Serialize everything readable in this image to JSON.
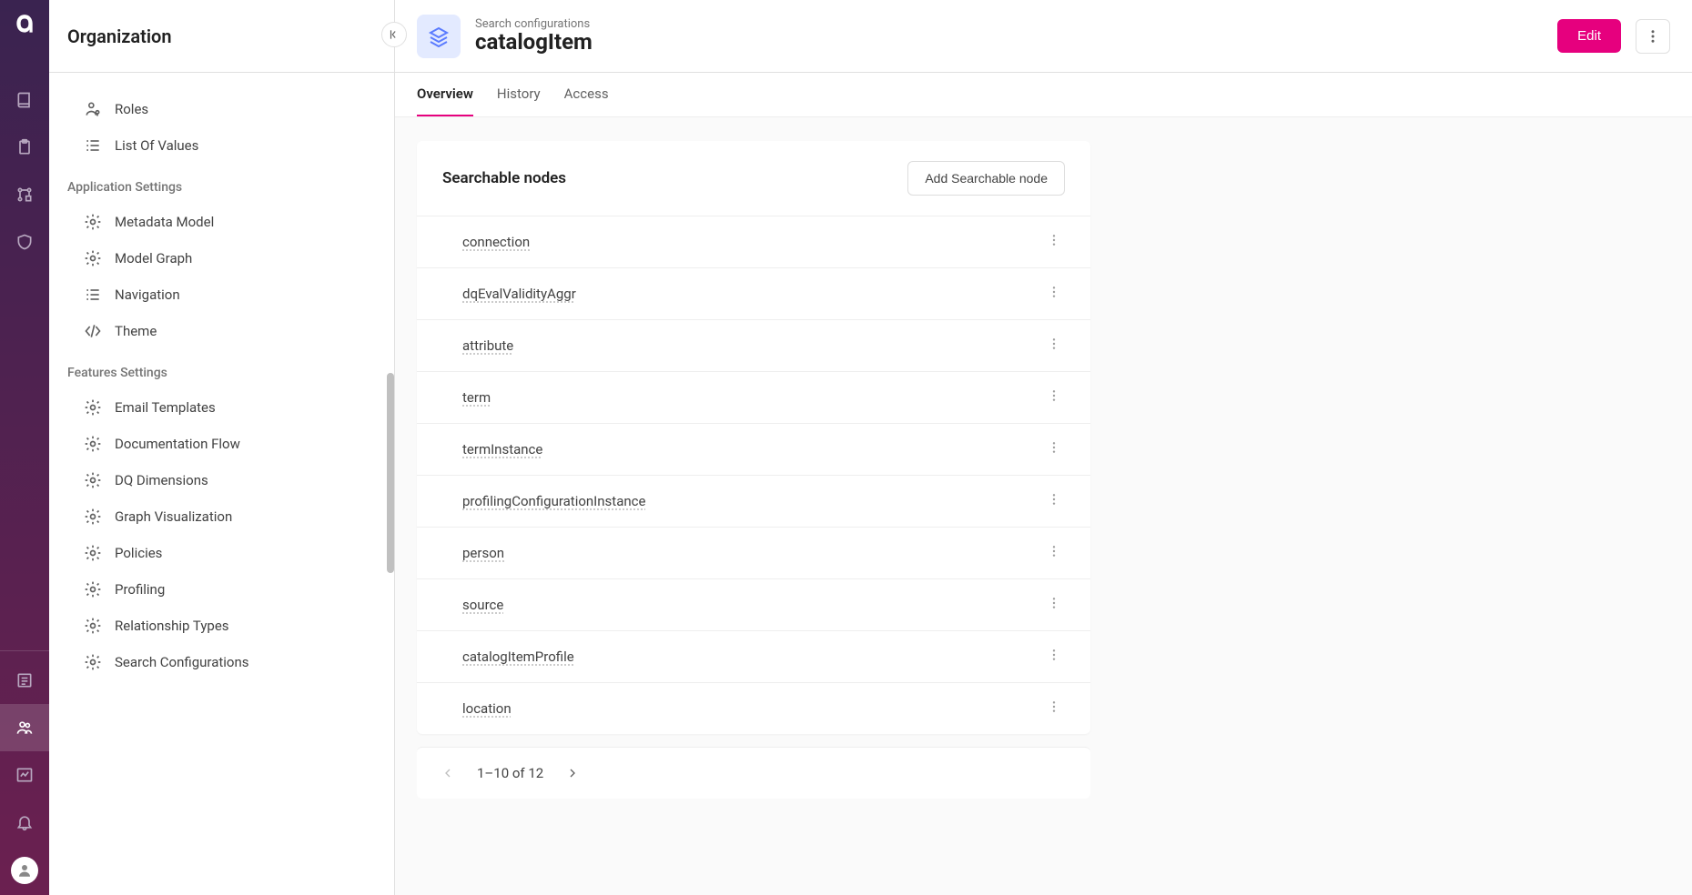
{
  "rail": {
    "logo": "a"
  },
  "sidebar": {
    "title": "Organization",
    "groups": [
      {
        "items": [
          {
            "label": "Roles"
          },
          {
            "label": "List Of Values"
          }
        ]
      },
      {
        "heading": "Application Settings",
        "items": [
          {
            "label": "Metadata Model"
          },
          {
            "label": "Model Graph"
          },
          {
            "label": "Navigation"
          },
          {
            "label": "Theme"
          }
        ]
      },
      {
        "heading": "Features Settings",
        "items": [
          {
            "label": "Email Templates"
          },
          {
            "label": "Documentation Flow"
          },
          {
            "label": "DQ Dimensions"
          },
          {
            "label": "Graph Visualization"
          },
          {
            "label": "Policies"
          },
          {
            "label": "Profiling"
          },
          {
            "label": "Relationship Types"
          },
          {
            "label": "Search Configurations"
          }
        ]
      }
    ]
  },
  "header": {
    "subtitle": "Search configurations",
    "title": "catalogItem",
    "edit": "Edit"
  },
  "tabs": [
    {
      "label": "Overview",
      "active": true
    },
    {
      "label": "History",
      "active": false
    },
    {
      "label": "Access",
      "active": false
    }
  ],
  "card": {
    "title": "Searchable nodes",
    "add_button": "Add Searchable node",
    "rows": [
      "connection",
      "dqEvalValidityAggr",
      "attribute",
      "term",
      "termInstance",
      "profilingConfigurationInstance",
      "person",
      "source",
      "catalogItemProfile",
      "location"
    ],
    "pager": "1–10 of 12"
  }
}
